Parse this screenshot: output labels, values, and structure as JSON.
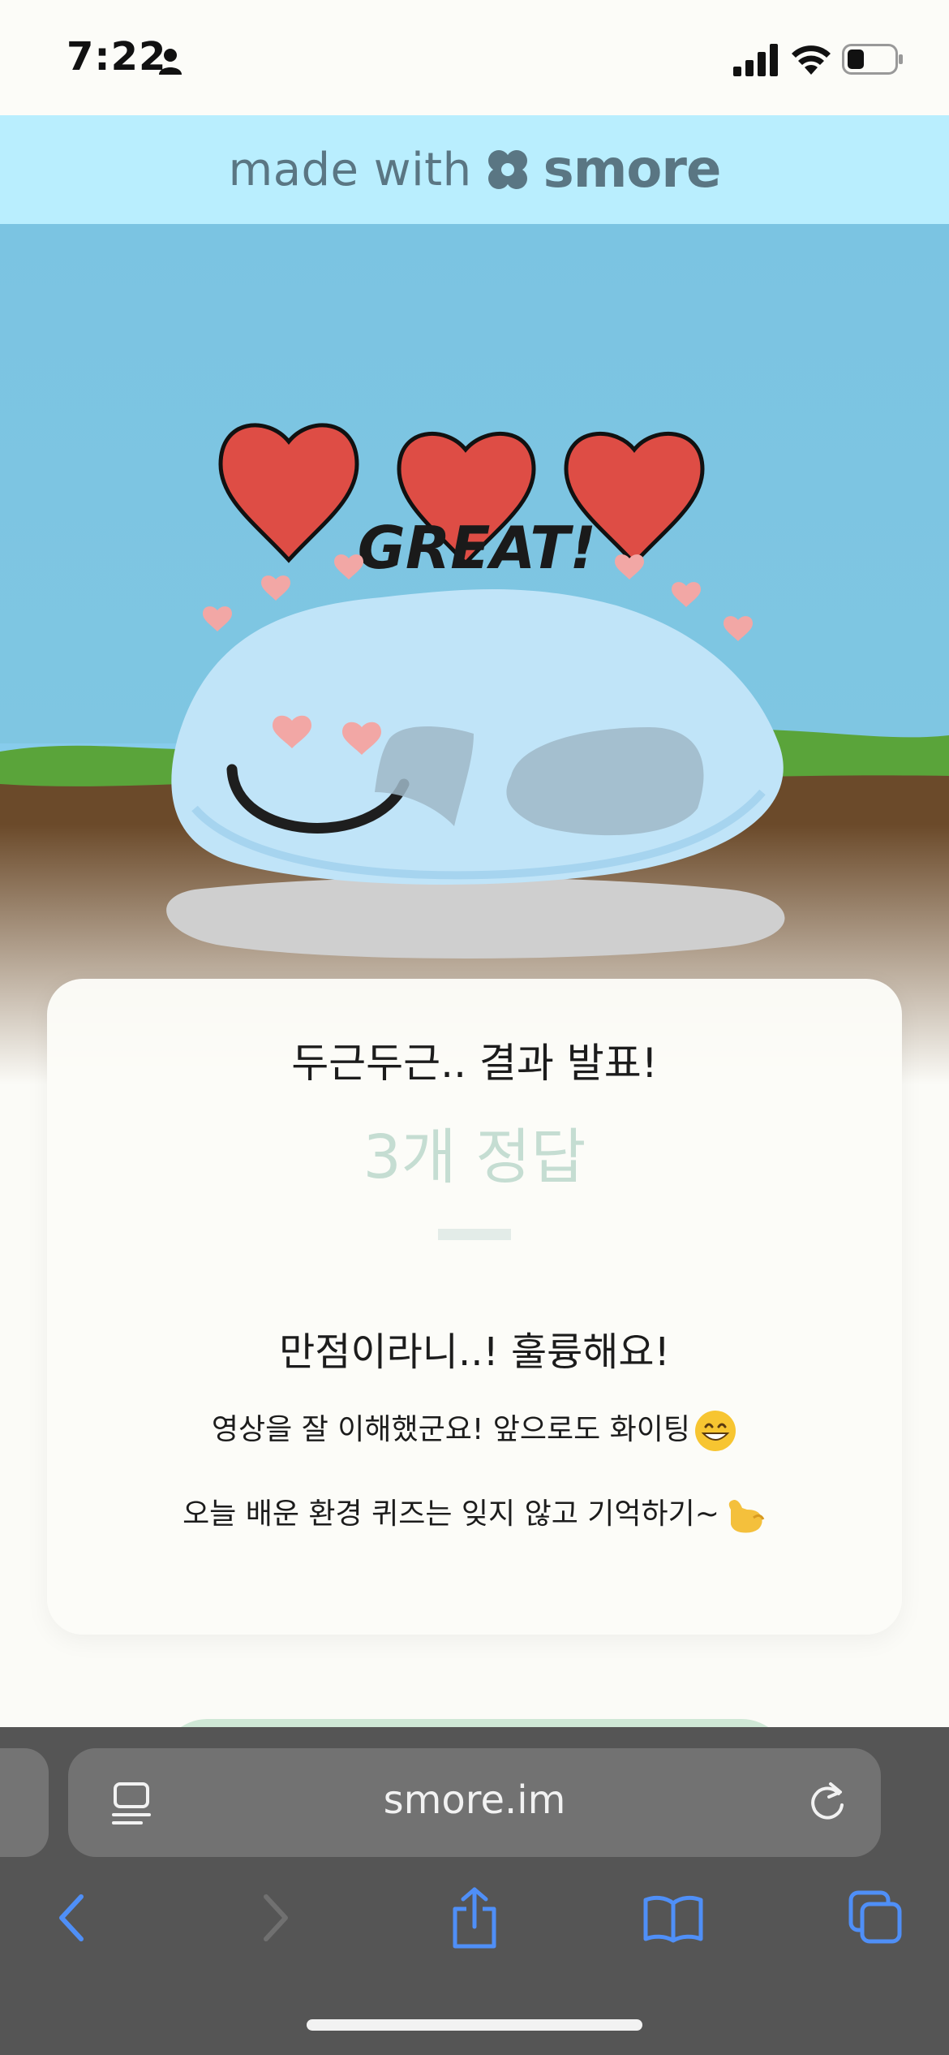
{
  "status_bar": {
    "time": "7:22",
    "battery_level": 0.35
  },
  "banner": {
    "prefix": "made with",
    "brand": "smore"
  },
  "hero": {
    "hearts": 3,
    "exclamation": "GREAT!",
    "colors": {
      "sky": "#7bc4e2",
      "grass": "#5aa43a",
      "soil": "#6b4a2a",
      "heart": "#de4d45",
      "blob": "#c0e4f8"
    }
  },
  "result": {
    "title": "두근두근.. 결과 발표!",
    "score": "3개 정답",
    "headline": "만점이라니..! 훌륭해요!",
    "line1": "영상을 잘 이해했군요! 앞으로도 화이팅",
    "line2": "오늘 배운 환경 퀴즈는 잊지 않고 기억하기~"
  },
  "browser": {
    "url": "smore.im",
    "accent": "#3b82f6"
  }
}
